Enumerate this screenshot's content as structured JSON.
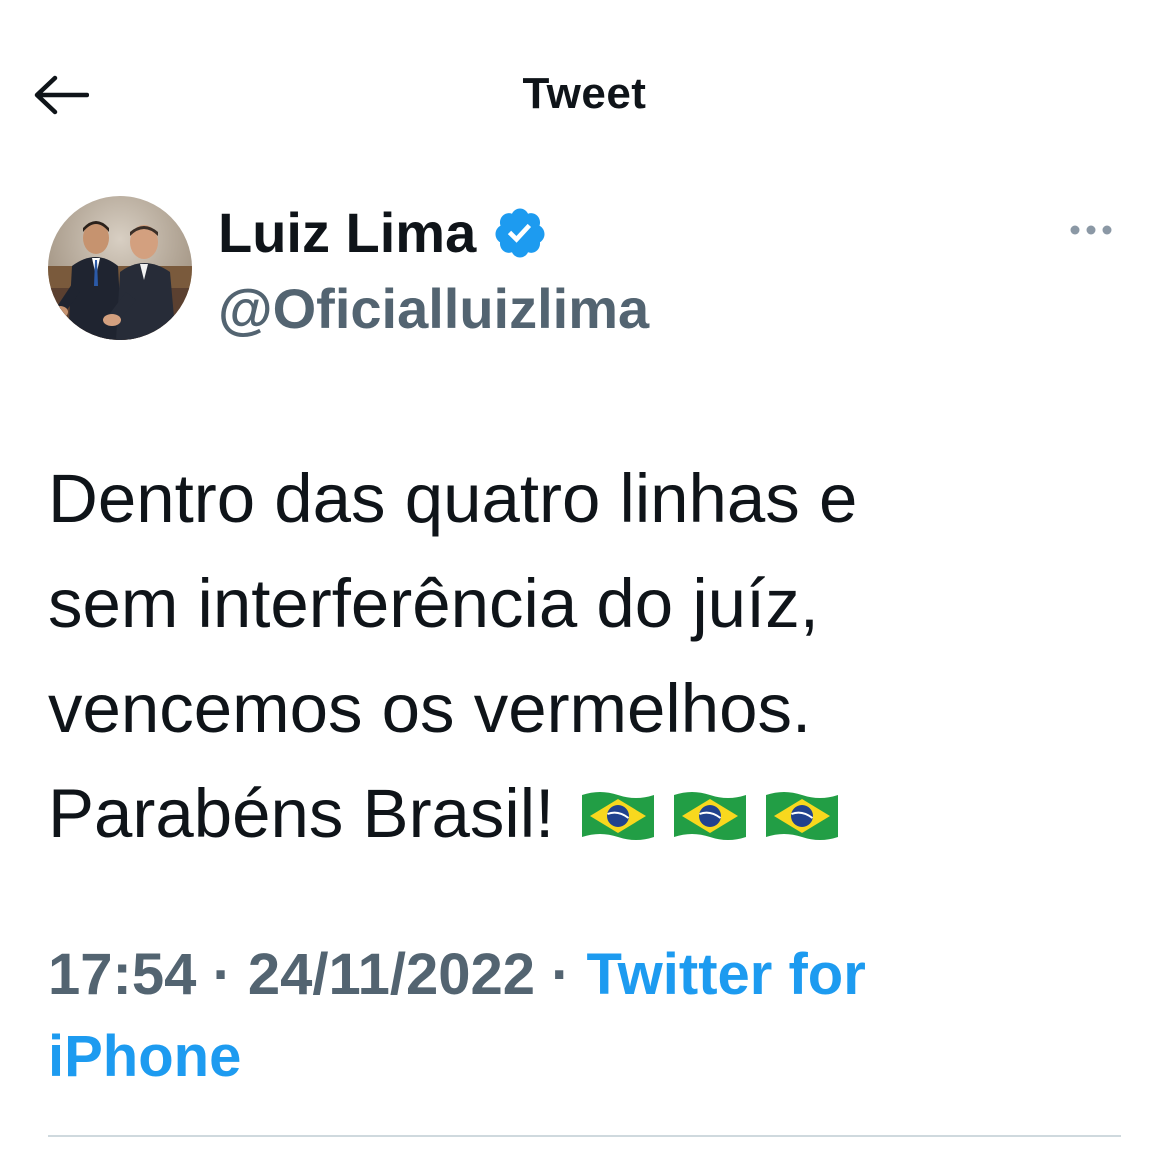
{
  "header": {
    "title": "Tweet",
    "back_icon": "arrow-left-icon"
  },
  "author": {
    "display_name": "Luiz Lima",
    "handle": "@Oficialluizlima",
    "verified": true,
    "verified_icon": "verified-badge-icon",
    "more_icon": "more-horizontal-icon"
  },
  "tweet": {
    "text": "Dentro das quatro linhas e\nsem interferência do juíz,\nvencemos os vermelhos.\nParabéns Brasil!",
    "emojis": [
      "brazil-flag-emoji",
      "brazil-flag-emoji",
      "brazil-flag-emoji"
    ]
  },
  "meta": {
    "time": "17:54",
    "separator": " · ",
    "date": "24/11/2022",
    "source": "Twitter for iPhone"
  },
  "colors": {
    "text": "#0f1419",
    "secondary": "#536471",
    "link": "#1d9bf0",
    "verified": "#1d9bf0",
    "divider": "#cfd9de"
  }
}
